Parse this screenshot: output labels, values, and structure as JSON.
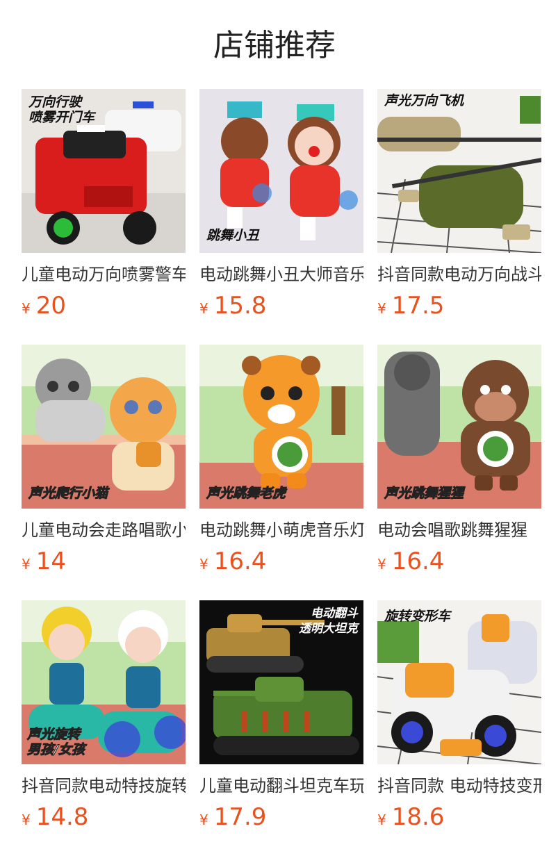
{
  "title": "店铺推荐",
  "products": [
    {
      "name": "儿童电动万向喷雾警车",
      "currency": "¥",
      "price": "20",
      "image_text": "万向行驶\n喷雾开门车",
      "image_icon": "police-truck-toy-image"
    },
    {
      "name": "电动跳舞小丑大师音乐",
      "currency": "¥",
      "price": "15.8",
      "image_text": "跳舞小丑",
      "image_icon": "dancing-clown-toy-image"
    },
    {
      "name": "抖音同款电动万向战斗机",
      "currency": "¥",
      "price": "17.5",
      "image_text": "声光万向飞机",
      "image_icon": "helicopter-toy-image"
    },
    {
      "name": "儿童电动会走路唱歌小猫",
      "currency": "¥",
      "price": "14",
      "image_text": "声光爬行小猫",
      "image_icon": "crawling-cat-toy-image"
    },
    {
      "name": "电动跳舞小萌虎音乐灯光",
      "currency": "¥",
      "price": "16.4",
      "image_text": "声光跳舞老虎",
      "image_icon": "dancing-tiger-toy-image"
    },
    {
      "name": "电动会唱歌跳舞猩猩",
      "currency": "¥",
      "price": "16.4",
      "image_text": "声光跳舞猩猩",
      "image_icon": "dancing-gorilla-toy-image"
    },
    {
      "name": "抖音同款电动特技旋转平衡车",
      "currency": "¥",
      "price": "14.8",
      "image_text": "声光旋转\n男孩/女孩",
      "image_icon": "balance-scooter-kids-toy-image"
    },
    {
      "name": "儿童电动翻斗坦克车玩具",
      "currency": "¥",
      "price": "17.9",
      "image_text": "电动翻斗\n透明大坦克",
      "image_icon": "tank-toy-image"
    },
    {
      "name": "抖音同款 电动特技变形摩托",
      "currency": "¥",
      "price": "18.6",
      "image_text": "旋转变形车",
      "image_icon": "transforming-motorbike-toy-image"
    }
  ]
}
